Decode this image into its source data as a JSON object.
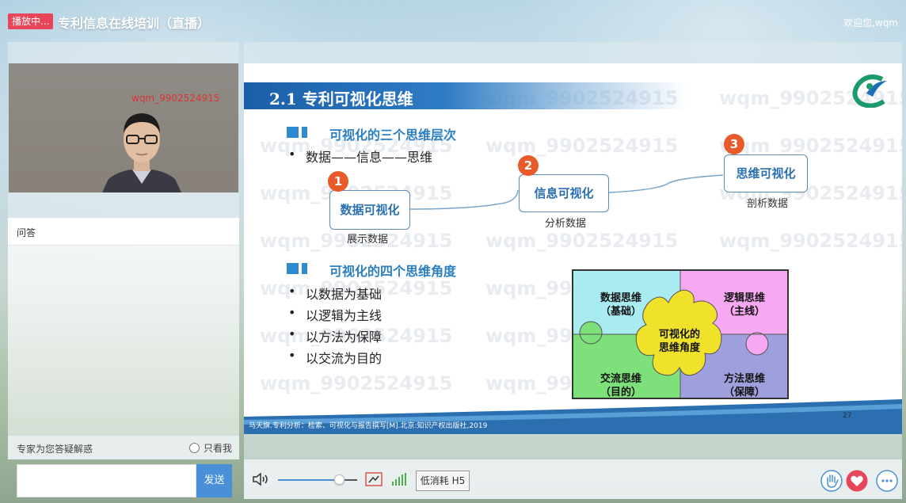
{
  "header": {
    "live_badge": "播放中...",
    "title": "专利信息在线培训（直播）",
    "welcome": "欢迎您,wqm"
  },
  "video": {
    "watermark": "wqm_9902524915"
  },
  "qa": {
    "tab_label": "问答",
    "expert_label": "专家为您答疑解惑",
    "only_me_label": "只看我",
    "input_value": "",
    "send_label": "发送"
  },
  "slide": {
    "watermark_text": "wqm_9902524915",
    "title": "2.1 专利可视化思维",
    "section1": {
      "heading": "可视化的三个思维层次",
      "bullet": "数据——信息——思维"
    },
    "flow": [
      {
        "num": "1",
        "label": "数据可视化",
        "caption": "展示数据"
      },
      {
        "num": "2",
        "label": "信息可视化",
        "caption": "分析数据"
      },
      {
        "num": "3",
        "label": "思维可视化",
        "caption": "剖析数据"
      }
    ],
    "section2": {
      "heading": "可视化的四个思维角度",
      "bullets": [
        "以数据为基础",
        "以逻辑为主线",
        "以方法为保障",
        "以交流为目的"
      ]
    },
    "puzzle": {
      "top_left": [
        "数据思维",
        "（基础）"
      ],
      "top_right": [
        "逻辑思维",
        "（主线）"
      ],
      "bottom_left": [
        "交流思维",
        "（目的）"
      ],
      "bottom_right": [
        "方法思维",
        "（保障）"
      ],
      "center": [
        "可视化的",
        "思维角度"
      ],
      "colors": {
        "top_left": "#a8ecf2",
        "top_right": "#f6a8f2",
        "bottom_left": "#7ee07a",
        "bottom_right": "#9f9fde",
        "center": "#f0e22a"
      }
    },
    "citation": "马天旗.专利分析：检索、可视化与报告撰写[M].北京:知识产权出版社,2019",
    "page_number": "27"
  },
  "controls": {
    "mode_label": "低消耗 H5",
    "icons": [
      "volume-icon",
      "screen-share-icon",
      "signal-icon",
      "raise-hand-icon",
      "like-heart-icon",
      "more-icon"
    ],
    "accent": "#4a90d9"
  }
}
